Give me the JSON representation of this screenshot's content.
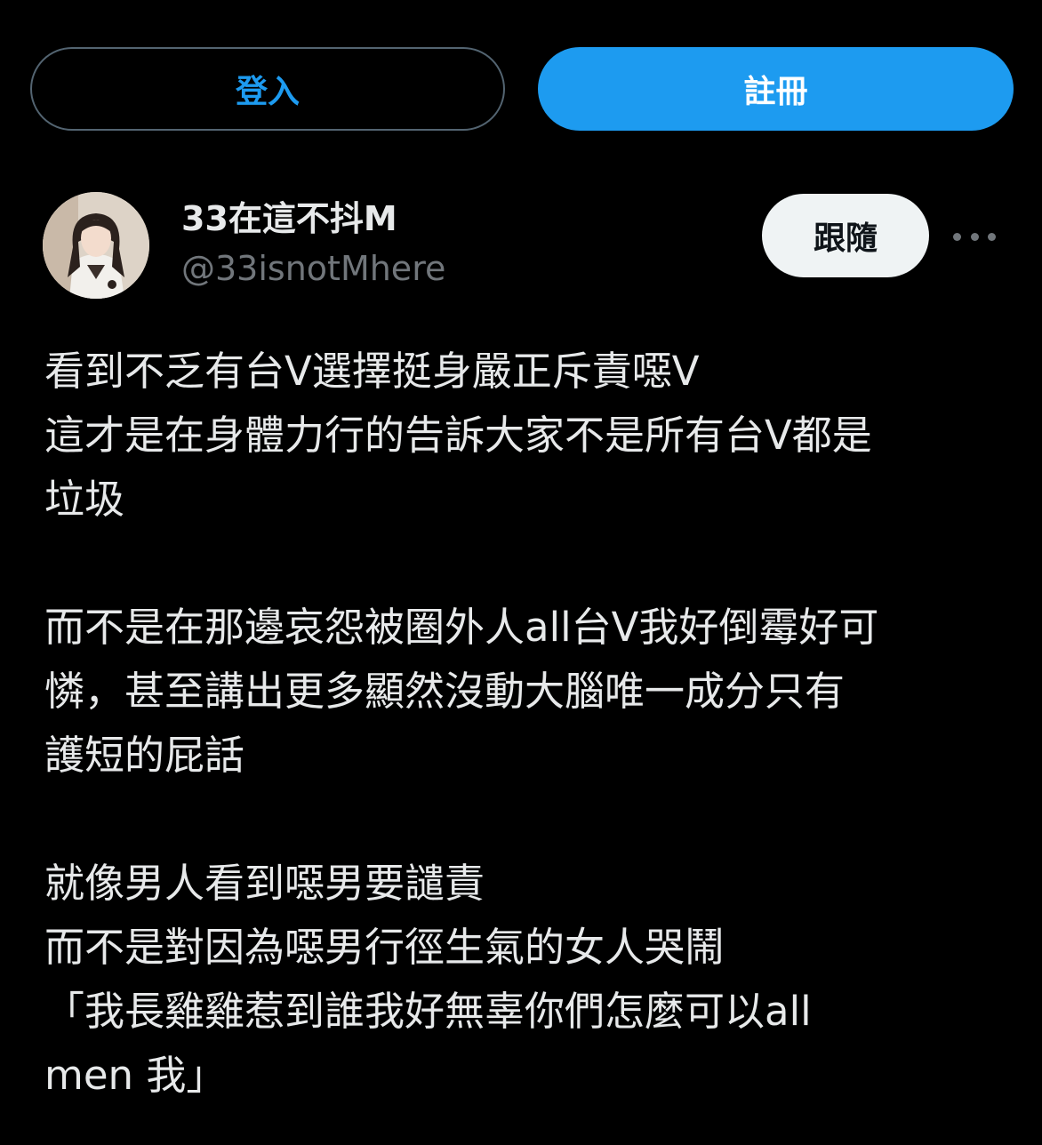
{
  "auth": {
    "login_label": "登入",
    "signup_label": "註冊"
  },
  "user": {
    "display_name": "33在這不抖M",
    "handle": "@33isnotMhere",
    "follow_label": "跟隨"
  },
  "tweet": {
    "paragraphs": [
      {
        "lines": [
          "看到不乏有台V選擇挺身嚴正斥責噁V",
          "這才是在身體力行的告訴大家不是所有台V都是",
          "垃圾"
        ]
      },
      {
        "lines": [
          "而不是在那邊哀怨被圈外人all台V我好倒霉好可",
          "憐，甚至講出更多顯然沒動大腦唯一成分只有",
          "護短的屁話"
        ]
      },
      {
        "lines": [
          "就像男人看到噁男要譴責",
          "而不是對因為噁男行徑生氣的女人哭鬧",
          "「我長雞雞惹到誰我好無辜你們怎麼可以all",
          "men 我」"
        ]
      }
    ]
  },
  "icons": {
    "more": "more-horizontal-icon",
    "avatar": "user-avatar"
  },
  "colors": {
    "background": "#000000",
    "accent": "#1d9bf0",
    "text_primary": "#e7e9ea",
    "text_secondary": "#71767b",
    "follow_bg": "#eff3f4"
  }
}
